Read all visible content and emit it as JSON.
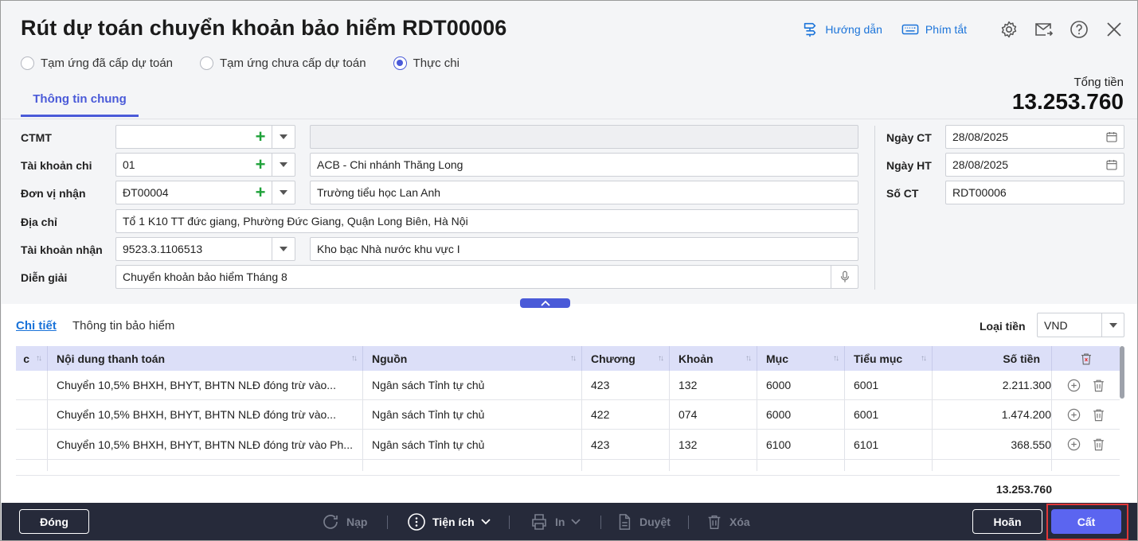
{
  "header": {
    "title": "Rút dự toán chuyển khoản bảo hiểm RDT00006",
    "guide_label": "Hướng dẫn",
    "shortcut_label": "Phím tắt"
  },
  "radios": [
    {
      "label": "Tạm ứng đã cấp dự toán",
      "checked": false
    },
    {
      "label": "Tạm ứng chưa cấp dự toán",
      "checked": false
    },
    {
      "label": "Thực chi",
      "checked": true
    }
  ],
  "tab_general": "Thông tin chung",
  "total": {
    "label": "Tổng tiền",
    "value": "13.253.760"
  },
  "form": {
    "ctmt": {
      "label": "CTMT",
      "value": "",
      "name": ""
    },
    "tk_chi": {
      "label": "Tài khoản chi",
      "value": "01",
      "name": "ACB - Chi nhánh Thăng Long"
    },
    "don_vi": {
      "label": "Đơn vị nhận",
      "value": "ĐT00004",
      "name": "Trường tiểu học Lan Anh"
    },
    "dia_chi": {
      "label": "Địa chỉ",
      "value": "Tổ 1 K10 TT đức giang, Phường Đức Giang, Quận Long Biên, Hà Nội"
    },
    "tk_nhan": {
      "label": "Tài khoản nhận",
      "value": "9523.3.1106513",
      "name": "Kho bạc Nhà nước khu vực I"
    },
    "dien_giai": {
      "label": "Diễn giải",
      "value": "Chuyển khoản bảo hiểm Tháng 8"
    },
    "ngay_ct": {
      "label": "Ngày CT",
      "value": "28/08/2025"
    },
    "ngay_ht": {
      "label": "Ngày HT",
      "value": "28/08/2025"
    },
    "so_ct": {
      "label": "Số CT",
      "value": "RDT00006"
    }
  },
  "detail": {
    "tab_detail": "Chi tiết",
    "tab_insurance": "Thông tin bảo hiểm",
    "currency_label": "Loại tiền",
    "currency_value": "VND",
    "columns": [
      "c",
      "Nội dung thanh toán",
      "Nguồn",
      "Chương",
      "Khoản",
      "Mục",
      "Tiểu mục",
      "Số tiền"
    ],
    "rows": [
      {
        "c": "",
        "noi_dung": "Chuyển 10,5% BHXH, BHYT, BHTN NLĐ đóng trừ vào...",
        "nguon": "Ngân sách Tỉnh tự chủ",
        "chuong": "423",
        "khoan": "132",
        "muc": "6000",
        "tieu_muc": "6001",
        "so_tien": "2.211.300"
      },
      {
        "c": "",
        "noi_dung": "Chuyển 10,5% BHXH, BHYT, BHTN NLĐ đóng trừ vào...",
        "nguon": "Ngân sách Tỉnh tự chủ",
        "chuong": "422",
        "khoan": "074",
        "muc": "6000",
        "tieu_muc": "6001",
        "so_tien": "1.474.200"
      },
      {
        "c": "",
        "noi_dung": "Chuyển 10,5% BHXH, BHYT, BHTN NLĐ đóng trừ vào Ph...",
        "nguon": "Ngân sách Tỉnh tự chủ",
        "chuong": "423",
        "khoan": "132",
        "muc": "6100",
        "tieu_muc": "6101",
        "so_tien": "368.550"
      }
    ],
    "sum": "13.253.760"
  },
  "footer": {
    "close": "Đóng",
    "reload": "Nạp",
    "utilities": "Tiện ích",
    "print": "In",
    "approve": "Duyệt",
    "delete": "Xóa",
    "cancel": "Hoãn",
    "save": "Cất"
  },
  "colors": {
    "accent": "#4a5ad8",
    "link": "#1a73d9",
    "footer_bg": "#262a3a",
    "highlight": "#e23838"
  }
}
